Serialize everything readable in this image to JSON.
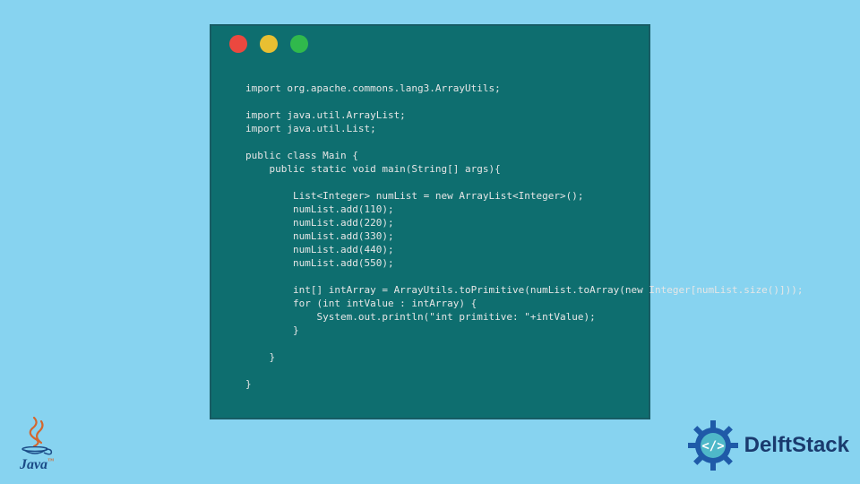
{
  "window": {
    "traffic_lights": [
      {
        "name": "red-dot",
        "color": "#eb483f"
      },
      {
        "name": "yellow-dot",
        "color": "#e8bf32"
      },
      {
        "name": "green-dot",
        "color": "#30b94c"
      }
    ]
  },
  "code": {
    "lines": [
      "import org.apache.commons.lang3.ArrayUtils;",
      "",
      "import java.util.ArrayList;",
      "import java.util.List;",
      "",
      "public class Main {",
      "    public static void main(String[] args){",
      "",
      "        List<Integer> numList = new ArrayList<Integer>();",
      "        numList.add(110);",
      "        numList.add(220);",
      "        numList.add(330);",
      "        numList.add(440);",
      "        numList.add(550);",
      "",
      "        int[] intArray = ArrayUtils.toPrimitive(numList.toArray(new Integer[numList.size()]));",
      "        for (int intValue : intArray) {",
      "            System.out.println(\"int primitive: \"+intValue);",
      "        }",
      "",
      "    }",
      "",
      "}"
    ]
  },
  "logos": {
    "java": {
      "label": "Java",
      "tm": "™"
    },
    "delft": {
      "label": "DelftStack"
    }
  }
}
